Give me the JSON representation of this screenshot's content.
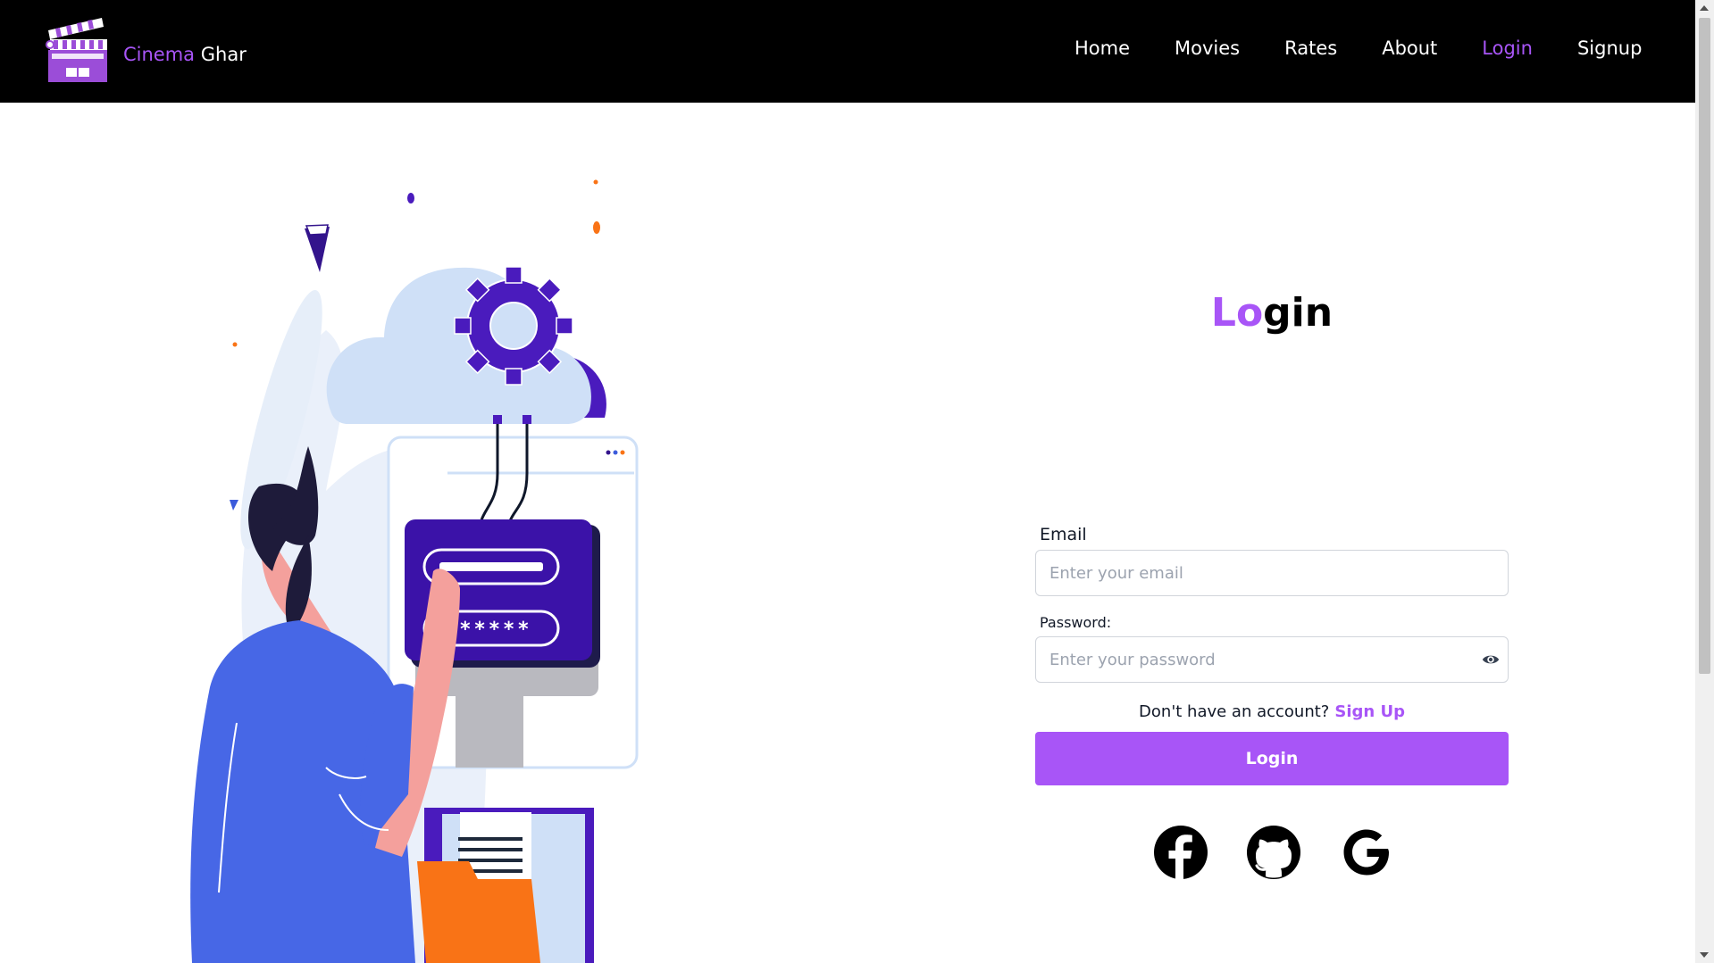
{
  "brand": {
    "name_accent": "Cinema",
    "name_rest": "Ghar",
    "logo_icon": "clapperboard-icon",
    "accent_color": "#a855f7"
  },
  "nav": {
    "items": [
      {
        "label": "Home"
      },
      {
        "label": "Movies"
      },
      {
        "label": "Rates"
      },
      {
        "label": "About"
      },
      {
        "label": "Login"
      },
      {
        "label": "Signup"
      }
    ],
    "active": "Login"
  },
  "login": {
    "title_accent": "Lo",
    "title_rest": "gin",
    "email_label": "Email",
    "email_placeholder": "Enter your email",
    "password_label": "Password:",
    "password_placeholder": "Enter your password",
    "password_toggle_icon": "eye-icon",
    "no_account_text": "Don't have an account?",
    "signup_link": "Sign Up",
    "submit_label": "Login",
    "button_color": "#a855f7"
  },
  "social": {
    "icons": [
      "facebook-icon",
      "github-icon",
      "google-icon"
    ]
  },
  "illustration": {
    "password_mask": "******"
  }
}
